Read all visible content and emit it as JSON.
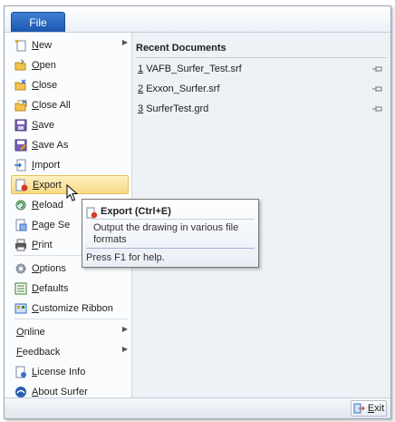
{
  "file_tab": "File",
  "menu": {
    "new": "New",
    "open": "Open",
    "close": "Close",
    "close_all": "Close All",
    "save": "Save",
    "save_as": "Save As",
    "import": "Import",
    "export": "Export",
    "reload": "Reload",
    "page_setup": "Page Se",
    "print": "Print",
    "options": "Options",
    "defaults": "Defaults",
    "customize_ribbon": "Customize Ribbon",
    "online": "Online",
    "feedback": "Feedback",
    "license_info": "License Info",
    "about": "About Surfer"
  },
  "recent": {
    "title": "Recent Documents",
    "docs": [
      {
        "num": "1",
        "name": "VAFB_Surfer_Test.srf"
      },
      {
        "num": "2",
        "name": "Exxon_Surfer.srf"
      },
      {
        "num": "3",
        "name": "SurferTest.grd"
      }
    ]
  },
  "tooltip": {
    "title": "Export (Ctrl+E)",
    "description": "Output the drawing in various file formats",
    "help": "Press F1 for help."
  },
  "exit_button": "Exit"
}
